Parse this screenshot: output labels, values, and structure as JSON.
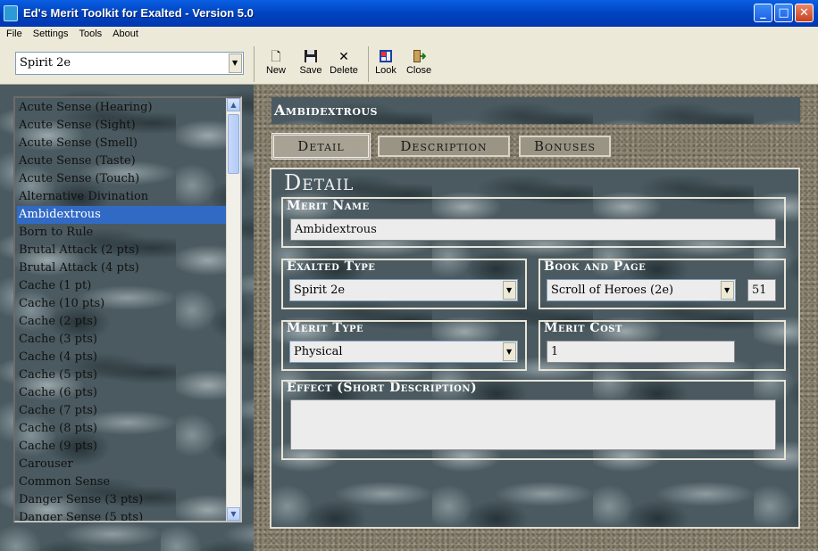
{
  "window": {
    "title": "Ed's Merit Toolkit for Exalted - Version 5.0",
    "btn_min": "_",
    "btn_max": "□",
    "btn_close": "✕"
  },
  "menu": [
    "File",
    "Settings",
    "Tools",
    "About"
  ],
  "toolbar": {
    "filter_value": "Spirit 2e",
    "buttons": [
      {
        "label": "New",
        "icon": "new-file-icon"
      },
      {
        "label": "Save",
        "icon": "floppy-save-icon"
      },
      {
        "label": "Delete",
        "icon": "delete-x-icon"
      },
      {
        "label": "Look",
        "icon": "look-icon"
      },
      {
        "label": "Close",
        "icon": "exit-door-icon"
      }
    ]
  },
  "merits": [
    "Acute Sense (Hearing)",
    "Acute Sense (Sight)",
    "Acute Sense (Smell)",
    "Acute Sense (Taste)",
    "Acute Sense (Touch)",
    "Alternative Divination",
    "Ambidextrous",
    "Born to Rule",
    "Brutal Attack (2 pts)",
    "Brutal Attack (4 pts)",
    "Cache (1 pt)",
    "Cache (10 pts)",
    "Cache (2 pts)",
    "Cache (3 pts)",
    "Cache (4 pts)",
    "Cache (5 pts)",
    "Cache (6 pts)",
    "Cache (7 pts)",
    "Cache (8 pts)",
    "Cache (9 pts)",
    "Carouser",
    "Common Sense",
    "Danger Sense (3 pts)",
    "Danger Sense (5 pts)"
  ],
  "selected_index": 6,
  "header": {
    "title": "Ambidextrous"
  },
  "tabs": [
    "Detail",
    "Description",
    "Bonuses"
  ],
  "detail": {
    "section_title": "Detail",
    "merit_name_label": "Merit Name",
    "merit_name": "Ambidextrous",
    "exalted_type_label": "Exalted Type",
    "exalted_type": "Spirit 2e",
    "book_label": "Book and Page",
    "book": "Scroll of Heroes (2e)",
    "page": "51",
    "merit_type_label": "Merit Type",
    "merit_type": "Physical",
    "merit_cost_label": "Merit Cost",
    "merit_cost": "1",
    "effect_label": "Effect (Short Description)",
    "effect": ""
  }
}
